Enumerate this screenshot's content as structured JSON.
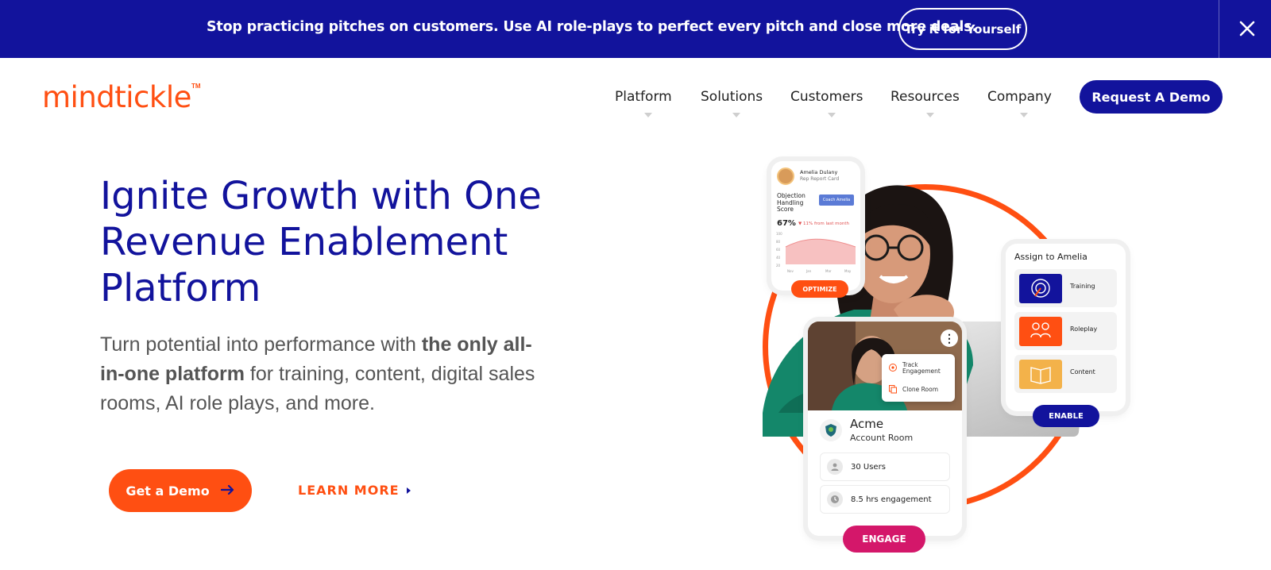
{
  "banner": {
    "text": "Stop practicing pitches on customers. Use AI role-plays to perfect every pitch and close more deals.",
    "cta_label": "Try it for Yourself",
    "close_icon": "close-icon",
    "background": "#12139c"
  },
  "header": {
    "logo_text": "mindtickle",
    "logo_tm": "TM",
    "nav": [
      {
        "label": "Platform"
      },
      {
        "label": "Solutions"
      },
      {
        "label": "Customers"
      },
      {
        "label": "Resources"
      },
      {
        "label": "Company"
      }
    ],
    "demo_button": "Request A Demo"
  },
  "hero": {
    "title": "Ignite Growth with One Revenue Enablement Platform",
    "subtitle_pre": "Turn potential into performance with ",
    "subtitle_bold": "the only all-in-one platform",
    "subtitle_post": " for training, content, digital sales rooms, AI role plays, and more.",
    "cta_demo": "Get a Demo",
    "cta_learn": "LEARN MORE"
  },
  "illustration": {
    "rep_card": {
      "name": "Amelia Dulany",
      "role": "Rep Report Card",
      "metric": "Objection Handling Score",
      "coach_label": "Coach Amelia",
      "percent": "67%",
      "delta": "▼ 11% from last month",
      "chart_months": [
        "Nov",
        "Jan",
        "Mar",
        "May"
      ],
      "chart_ticks": [
        "100",
        "80",
        "60",
        "40",
        "20"
      ]
    },
    "optimize_label": "OPTIMIZE",
    "assign_card": {
      "title": "Assign to Amelia",
      "items": [
        {
          "label": "Training",
          "icon": "training-icon",
          "color": "#12139c"
        },
        {
          "label": "Roleplay",
          "icon": "roleplay-icon",
          "color": "#ff4f12"
        },
        {
          "label": "Content",
          "icon": "content-icon",
          "color": "#f3b24a"
        }
      ]
    },
    "enable_label": "ENABLE",
    "acme_card": {
      "popup": [
        "Track Engagement",
        "Clone Room"
      ],
      "name": "Acme",
      "subtitle": "Account Room",
      "stats": [
        "30 Users",
        "8.5 hrs engagement"
      ]
    },
    "engage_label": "ENGAGE"
  },
  "colors": {
    "brand_orange": "#ff4f12",
    "brand_navy": "#12139c",
    "engage_pink": "#d4176a"
  }
}
